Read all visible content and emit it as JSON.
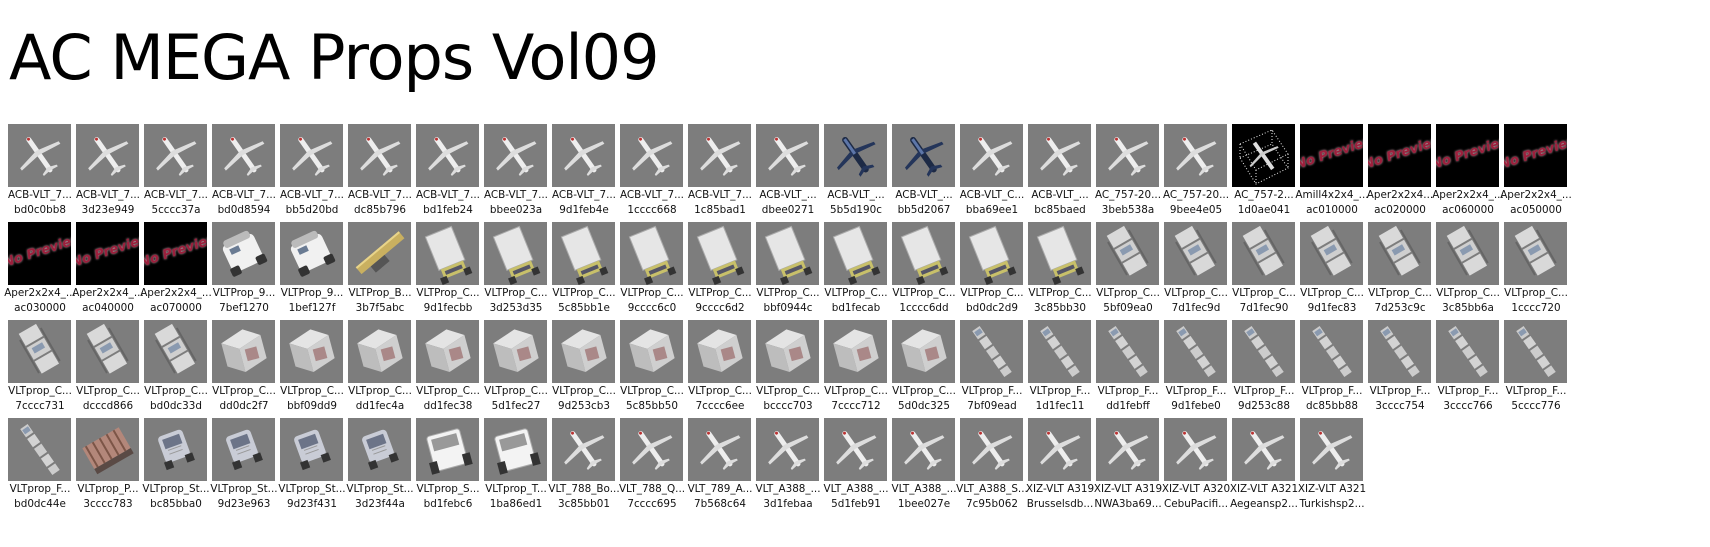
{
  "title": "AC MEGA Props Vol09",
  "items": [
    {
      "name": "ACB-VLT_7...",
      "hash": "bd0c0bb8",
      "kind": "plane"
    },
    {
      "name": "ACB-VLT_7...",
      "hash": "3d23e949",
      "kind": "plane"
    },
    {
      "name": "ACB-VLT_7...",
      "hash": "5cccc37a",
      "kind": "plane"
    },
    {
      "name": "ACB-VLT_7...",
      "hash": "bd0d8594",
      "kind": "plane"
    },
    {
      "name": "ACB-VLT_7...",
      "hash": "bb5d20bd",
      "kind": "plane"
    },
    {
      "name": "ACB-VLT_7...",
      "hash": "dc85b796",
      "kind": "plane"
    },
    {
      "name": "ACB-VLT_7...",
      "hash": "bd1feb24",
      "kind": "plane"
    },
    {
      "name": "ACB-VLT_7...",
      "hash": "bbee023a",
      "kind": "plane"
    },
    {
      "name": "ACB-VLT_7...",
      "hash": "9d1feb4e",
      "kind": "plane"
    },
    {
      "name": "ACB-VLT_7...",
      "hash": "1cccc668",
      "kind": "plane"
    },
    {
      "name": "ACB-VLT_7...",
      "hash": "1c85bad1",
      "kind": "plane"
    },
    {
      "name": "ACB-VLT_...",
      "hash": "dbee0271",
      "kind": "plane"
    },
    {
      "name": "ACB-VLT_...",
      "hash": "5b5d190c",
      "kind": "jet"
    },
    {
      "name": "ACB-VLT_...",
      "hash": "bb5d2067",
      "kind": "jet"
    },
    {
      "name": "ACB-VLT_C...",
      "hash": "bba69ee1",
      "kind": "plane"
    },
    {
      "name": "ACB-VLT_...",
      "hash": "bc85baed",
      "kind": "plane"
    },
    {
      "name": "AC_757-20...",
      "hash": "3beb538a",
      "kind": "plane"
    },
    {
      "name": "AC_757-20...",
      "hash": "9bee4e05",
      "kind": "plane"
    },
    {
      "name": "AC_757-2...",
      "hash": "1d0ae041",
      "kind": "wire"
    },
    {
      "name": "Amill4x2x4_...",
      "hash": "ac010000",
      "kind": "nopreview"
    },
    {
      "name": "Aper2x2x4...",
      "hash": "ac020000",
      "kind": "nopreview"
    },
    {
      "name": "Aper2x2x4_...",
      "hash": "ac060000",
      "kind": "nopreview"
    },
    {
      "name": "Aper2x2x4_...",
      "hash": "ac050000",
      "kind": "nopreview"
    },
    {
      "name": "Aper2x2x4_...",
      "hash": "ac030000",
      "kind": "nopreview"
    },
    {
      "name": "Aper2x2x4_...",
      "hash": "ac040000",
      "kind": "nopreview"
    },
    {
      "name": "Aper2x2x4_...",
      "hash": "ac070000",
      "kind": "nopreview"
    },
    {
      "name": "VLTProp_9...",
      "hash": "7bef1270",
      "kind": "vehicle"
    },
    {
      "name": "VLTProp_9...",
      "hash": "1bef127f",
      "kind": "vehicle"
    },
    {
      "name": "VLTProp_B...",
      "hash": "3b7f5abc",
      "kind": "belt"
    },
    {
      "name": "VLTProp_C...",
      "hash": "9d1fecbb",
      "kind": "truck"
    },
    {
      "name": "VLTProp_C...",
      "hash": "3d253d35",
      "kind": "truck"
    },
    {
      "name": "VLTProp_C...",
      "hash": "5c85bb1e",
      "kind": "truck"
    },
    {
      "name": "VLTProp_C...",
      "hash": "9cccc6c0",
      "kind": "truck"
    },
    {
      "name": "VLTProp_C...",
      "hash": "9cccc6d2",
      "kind": "truck"
    },
    {
      "name": "VLTProp_C...",
      "hash": "bbf0944c",
      "kind": "truck"
    },
    {
      "name": "VLTProp_C...",
      "hash": "bd1fecab",
      "kind": "truck"
    },
    {
      "name": "VLTProp_C...",
      "hash": "1cccc6dd",
      "kind": "truck"
    },
    {
      "name": "VLTProp_C...",
      "hash": "bd0dc2d9",
      "kind": "truck"
    },
    {
      "name": "VLTProp_C...",
      "hash": "3c85bb30",
      "kind": "truck"
    },
    {
      "name": "VLTprop_C...",
      "hash": "5bf09ea0",
      "kind": "cart"
    },
    {
      "name": "VLTprop_C...",
      "hash": "7d1fec9d",
      "kind": "cart"
    },
    {
      "name": "VLTprop_C...",
      "hash": "7d1fec90",
      "kind": "cart"
    },
    {
      "name": "VLTprop_C...",
      "hash": "9d1fec83",
      "kind": "cart"
    },
    {
      "name": "VLTprop_C...",
      "hash": "7d253c9c",
      "kind": "cart"
    },
    {
      "name": "VLTprop_C...",
      "hash": "3c85bb6a",
      "kind": "cart"
    },
    {
      "name": "VLTprop_C...",
      "hash": "1cccc720",
      "kind": "cart"
    },
    {
      "name": "VLTprop_C...",
      "hash": "7cccc731",
      "kind": "cart"
    },
    {
      "name": "VLTprop_C...",
      "hash": "dcccd866",
      "kind": "cart"
    },
    {
      "name": "VLTprop_C...",
      "hash": "bd0dc33d",
      "kind": "cart"
    },
    {
      "name": "VLTprop_C...",
      "hash": "dd0dc2f7",
      "kind": "container"
    },
    {
      "name": "VLTprop_C...",
      "hash": "bbf09dd9",
      "kind": "container"
    },
    {
      "name": "VLTprop_C...",
      "hash": "dd1fec4a",
      "kind": "container"
    },
    {
      "name": "VLTprop_C...",
      "hash": "dd1fec38",
      "kind": "container"
    },
    {
      "name": "VLTprop_C...",
      "hash": "5d1fec27",
      "kind": "container"
    },
    {
      "name": "VLTprop_C...",
      "hash": "9d253cb3",
      "kind": "container"
    },
    {
      "name": "VLTprop_C...",
      "hash": "5c85bb50",
      "kind": "container"
    },
    {
      "name": "VLTprop_C...",
      "hash": "7cccc6ee",
      "kind": "container"
    },
    {
      "name": "VLTprop_C...",
      "hash": "bcccc703",
      "kind": "container"
    },
    {
      "name": "VLTprop_C...",
      "hash": "7cccc712",
      "kind": "container"
    },
    {
      "name": "VLTprop_C...",
      "hash": "5d0dc325",
      "kind": "container"
    },
    {
      "name": "VLTprop_F...",
      "hash": "7bf09ead",
      "kind": "train"
    },
    {
      "name": "VLTprop_F...",
      "hash": "1d1fec11",
      "kind": "train"
    },
    {
      "name": "VLTprop_F...",
      "hash": "dd1febff",
      "kind": "train"
    },
    {
      "name": "VLTprop_F...",
      "hash": "9d1febe0",
      "kind": "train"
    },
    {
      "name": "VLTprop_F...",
      "hash": "9d253c88",
      "kind": "train"
    },
    {
      "name": "VLTprop_F...",
      "hash": "dc85bb88",
      "kind": "train"
    },
    {
      "name": "VLTprop_F...",
      "hash": "3cccc754",
      "kind": "train"
    },
    {
      "name": "VLTprop_F...",
      "hash": "3cccc766",
      "kind": "train"
    },
    {
      "name": "VLTprop_F...",
      "hash": "5cccc776",
      "kind": "train"
    },
    {
      "name": "VLTprop_F...",
      "hash": "bd0dc44e",
      "kind": "train"
    },
    {
      "name": "VLTprop_P...",
      "hash": "3cccc783",
      "kind": "pallet"
    },
    {
      "name": "VLTprop_St...",
      "hash": "bc85bba0",
      "kind": "stairs"
    },
    {
      "name": "VLTprop_St...",
      "hash": "9d23e963",
      "kind": "stairs"
    },
    {
      "name": "VLTprop_St...",
      "hash": "9d23f431",
      "kind": "stairs"
    },
    {
      "name": "VLTprop_St...",
      "hash": "3d23f44a",
      "kind": "stairs"
    },
    {
      "name": "VLTprop_S...",
      "hash": "bd1febc6",
      "kind": "tug"
    },
    {
      "name": "VLTprop_T...",
      "hash": "1ba86ed1",
      "kind": "tug"
    },
    {
      "name": "VLT_788_Bo...",
      "hash": "3c85bb01",
      "kind": "plane"
    },
    {
      "name": "VLT_788_Q...",
      "hash": "7cccc695",
      "kind": "plane"
    },
    {
      "name": "VLT_789_A...",
      "hash": "7b568c64",
      "kind": "plane"
    },
    {
      "name": "VLT_A388_...",
      "hash": "3d1febaa",
      "kind": "plane"
    },
    {
      "name": "VLT_A388_...",
      "hash": "5d1feb91",
      "kind": "plane"
    },
    {
      "name": "VLT_A388_...",
      "hash": "1bee027e",
      "kind": "plane"
    },
    {
      "name": "VLT_A388_S...",
      "hash": "7c95b062",
      "kind": "plane"
    },
    {
      "name": "XIZ-VLT A319",
      "hash": "Brusselsdb...",
      "kind": "plane"
    },
    {
      "name": "XIZ-VLT A319",
      "hash": "NWA3ba69...",
      "kind": "plane"
    },
    {
      "name": "XIZ-VLT A320",
      "hash": "CebuPacifi...",
      "kind": "plane"
    },
    {
      "name": "XIZ-VLT A321",
      "hash": "Aegeansp2...",
      "kind": "plane"
    },
    {
      "name": "XIZ-VLT A321",
      "hash": "Turkishsp2...",
      "kind": "plane"
    }
  ],
  "no_preview_text": "No Preview",
  "colors": {
    "thumb_bg": "#7d7d7d",
    "thumb_black": "#000000",
    "no_preview_red": "#9c1f3c"
  }
}
